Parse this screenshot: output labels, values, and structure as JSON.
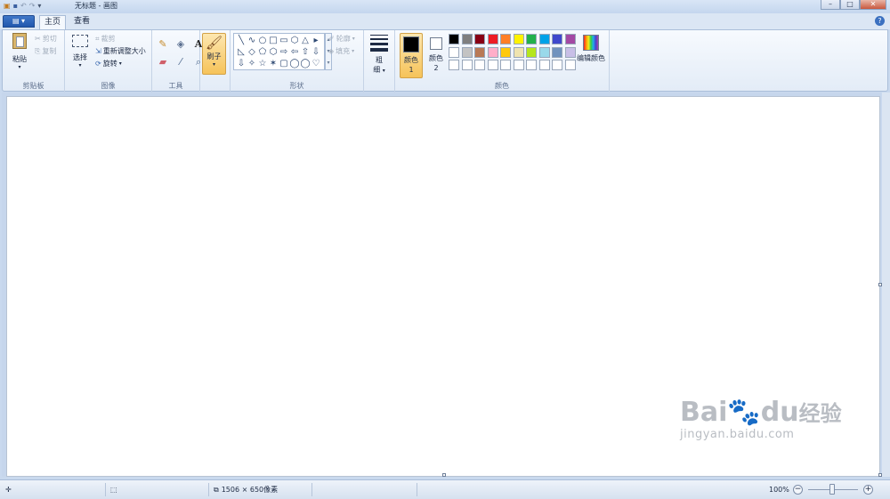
{
  "window": {
    "title": "无标题 - 画图",
    "qat_icons": [
      "paint-app-icon",
      "save-icon",
      "undo-icon",
      "redo-icon",
      "dropdown-icon"
    ]
  },
  "tabs": [
    {
      "label": "主页",
      "active": true
    },
    {
      "label": "查看",
      "active": false
    }
  ],
  "file_menu": {
    "label": "▤ ▾"
  },
  "clipboard": {
    "paste": "粘贴",
    "cut": "剪切",
    "copy": "复制",
    "label": "剪贴板"
  },
  "image": {
    "select": "选择",
    "crop": "裁剪",
    "resize": "重新调整大小",
    "rotate": "旋转",
    "label": "图像"
  },
  "tools": {
    "label": "工具"
  },
  "brushes": {
    "label": "刷子"
  },
  "shapes": {
    "outline": "轮廓",
    "fill": "填充",
    "label": "形状",
    "items": [
      "╲",
      "∿",
      "○",
      "□",
      "▭",
      "⬡",
      "△",
      "▸",
      "◺",
      "◇",
      "⬠",
      "⬡",
      "⇨",
      "⇦",
      "⇧",
      "⇩",
      "⇩",
      "✧",
      "☆",
      "✶",
      "▢",
      "◯",
      "◯",
      "♡"
    ]
  },
  "size": {
    "label1": "粗",
    "label2": "细"
  },
  "colors": {
    "color1_label": "颜色 1",
    "color2_label": "颜色 2",
    "color1_value": "#000000",
    "color2_value": "#ffffff",
    "edit": "编辑颜色",
    "label": "颜色",
    "palette_row1": [
      "#000000",
      "#7f7f7f",
      "#880015",
      "#ed1c24",
      "#ff7f27",
      "#fff200",
      "#22b14c",
      "#00a2e8",
      "#3f48cc",
      "#a349a4"
    ],
    "palette_row2": [
      "#ffffff",
      "#c3c3c3",
      "#b97a57",
      "#ffaec9",
      "#ffc90e",
      "#efe4b0",
      "#b5e61d",
      "#99d9ea",
      "#7092be",
      "#c8bfe7"
    ],
    "palette_row3": [
      "#ffffff",
      "#ffffff",
      "#ffffff",
      "#ffffff",
      "#ffffff",
      "#ffffff",
      "#ffffff",
      "#ffffff",
      "#ffffff",
      "#ffffff"
    ]
  },
  "status": {
    "image_size": "1506 × 650像素",
    "zoom": "100%"
  },
  "watermark": {
    "brand": "Bai🐾du",
    "cn": "经验",
    "url": "jingyan.baidu.com"
  }
}
